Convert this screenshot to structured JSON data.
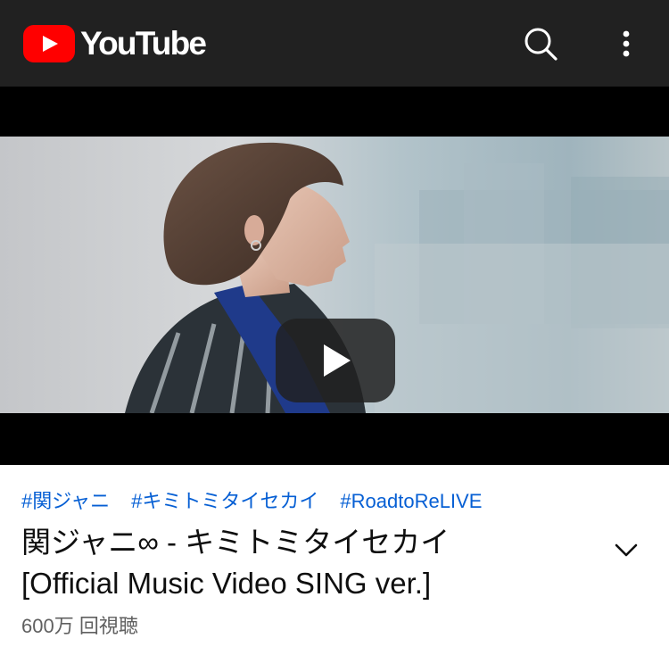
{
  "header": {
    "logo_text": "YouTube",
    "logo_color": "#ff0000",
    "background": "#212121",
    "icons": [
      "search-icon",
      "more-vert-icon"
    ]
  },
  "player": {
    "state": "paused",
    "icons": [
      "play-icon"
    ]
  },
  "video": {
    "hashtags": [
      "#関ジャニ",
      "#キミトミタイセカイ",
      "#RoadtoReLIVE"
    ],
    "title_lines": [
      "関ジャニ∞ - キミトミタイセカイ",
      "[Official Music Video SING ver.]"
    ],
    "views": "600万 回視聴",
    "expand_icon": "chevron-down-icon",
    "link_color": "#065fd4"
  }
}
